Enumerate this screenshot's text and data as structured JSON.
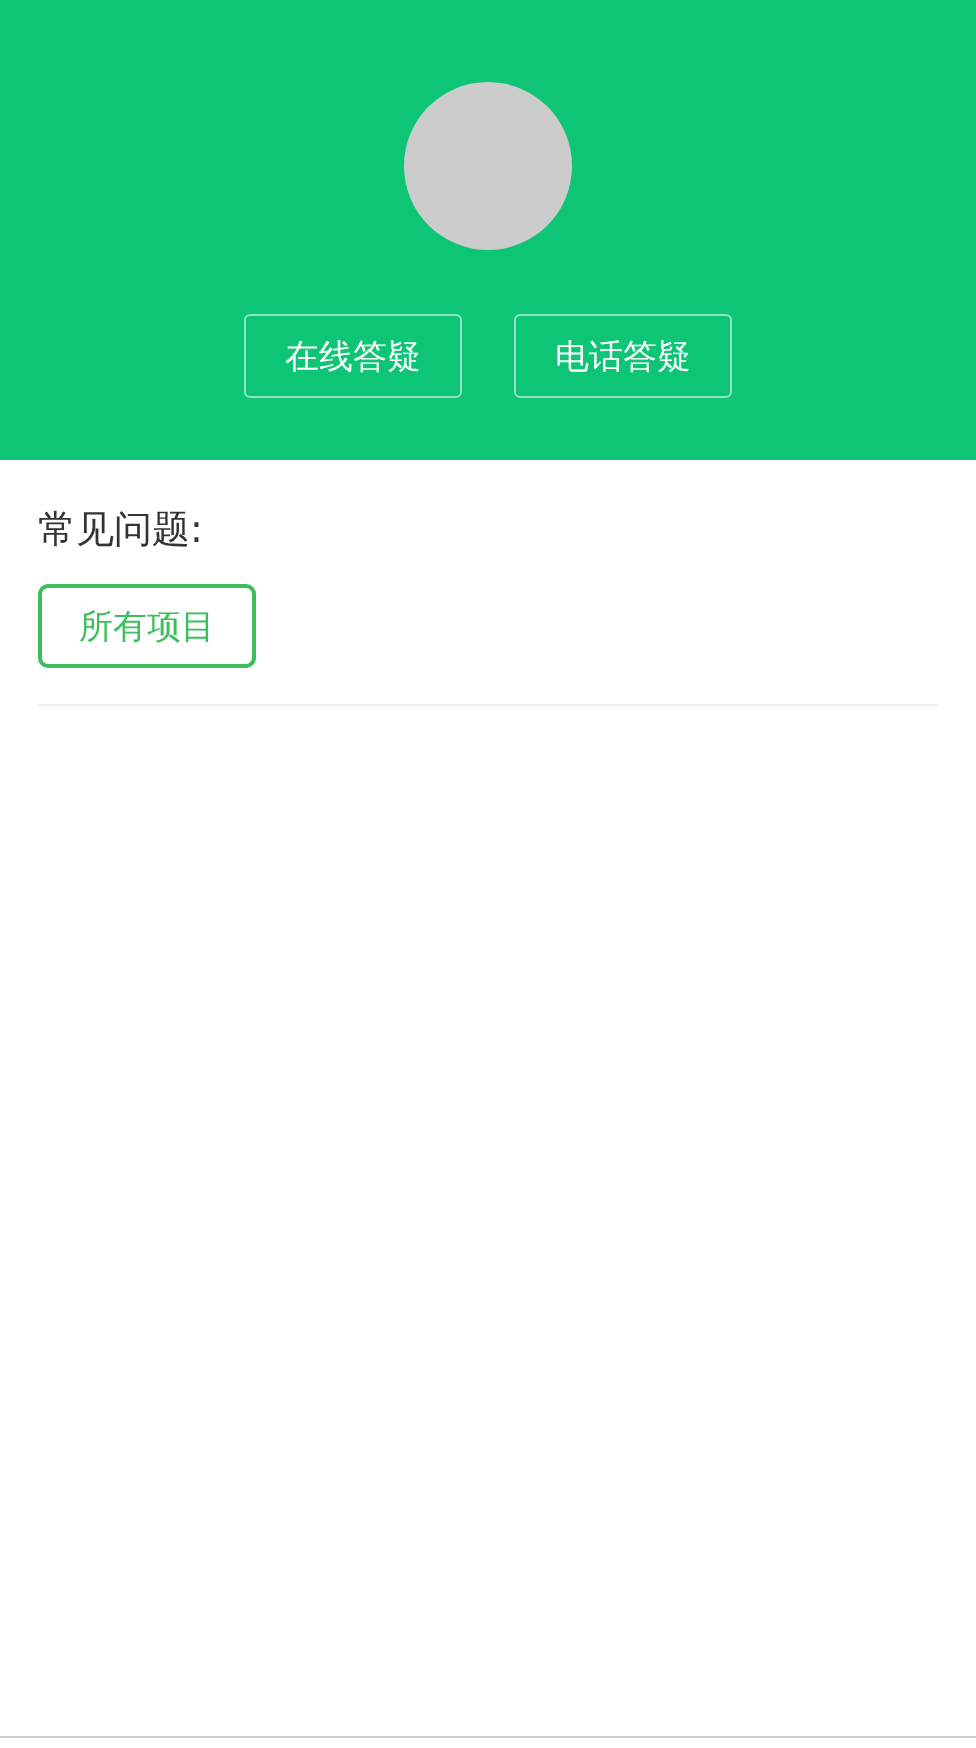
{
  "header": {
    "buttons": [
      "在线答疑",
      "电话答疑"
    ]
  },
  "faq": {
    "title": "常见问题:",
    "filters": [
      {
        "label": "所有项目",
        "selected": true
      }
    ]
  }
}
